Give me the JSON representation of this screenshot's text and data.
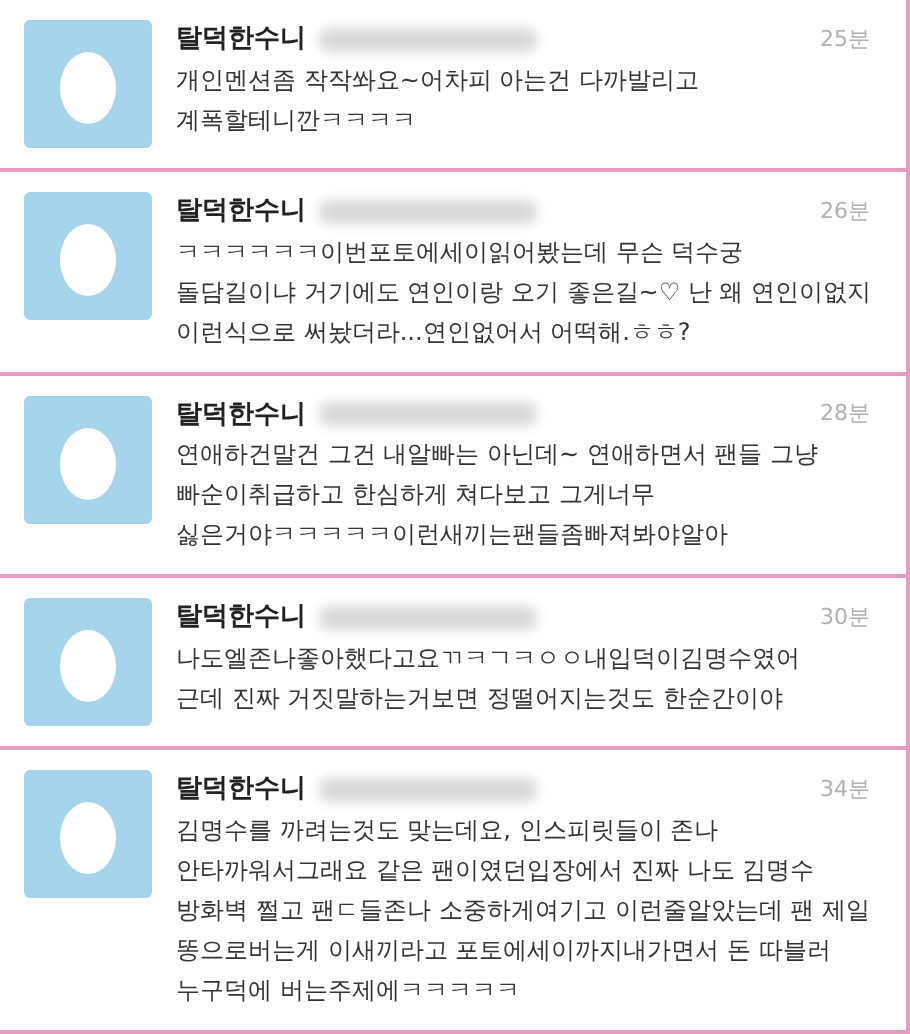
{
  "tweets": [
    {
      "name": "탈덕한수니",
      "time": "25분",
      "lines": [
        "개인멘션좀 작작쏴요~어차피 아는건 다까발리고",
        "계폭할테니깐ㅋㅋㅋㅋ"
      ]
    },
    {
      "name": "탈덕한수니",
      "time": "26분",
      "lines": [
        "ㅋㅋㅋㅋㅋㅋ이번포토에세이읽어봤는데 무슨 덕수궁",
        "돌담길이냐 거기에도 연인이랑 오기 좋은길~♡ 난 왜 연인이없지",
        "이런식으로 써놨더라...연인없어서 어떡해.ㅎㅎ?"
      ]
    },
    {
      "name": "탈덕한수니",
      "time": "28분",
      "lines": [
        "연애하건말건 그건 내알빠는 아닌데~ 연애하면서 팬들 그냥",
        "빠순이취급하고 한심하게 쳐다보고 그게너무",
        "싫은거야ㅋㅋㅋㅋㅋ이런새끼는팬들좀빠져봐야알아"
      ]
    },
    {
      "name": "탈덕한수니",
      "time": "30분",
      "lines": [
        "나도엘존나좋아했다고요ㄲㅋㄱㅋㅇㅇ내입덕이김명수였어",
        "근데 진짜 거짓말하는거보면 정떨어지는것도 한순간이야"
      ]
    },
    {
      "name": "탈덕한수니",
      "time": "34분",
      "lines": [
        "김명수를 까려는것도 맞는데요, 인스피릿들이 존나",
        "안타까워서그래요 같은 팬이였던입장에서 진짜 나도 김명수",
        "방화벽 쩔고 팬ㄷ들존나 소중하게여기고 이런줄알았는데 팬 제일",
        "똥으로버는게 이새끼라고 포토에세이까지내가면서 돈 따블러",
        "누구덕에 버는주제에ㅋㅋㅋㅋㅋ"
      ]
    }
  ]
}
